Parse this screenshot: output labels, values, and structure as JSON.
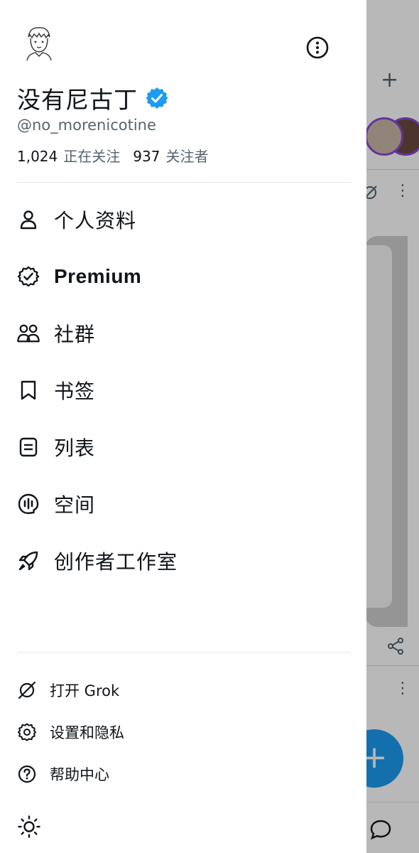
{
  "profile": {
    "display_name": "没有尼古丁",
    "handle": "@no_morenicotine",
    "following_count": "1,024",
    "following_label": "正在关注",
    "followers_count": "937",
    "followers_label": "关注者"
  },
  "menu": [
    {
      "label": "个人资料",
      "icon": "person-icon"
    },
    {
      "label": "Premium",
      "icon": "premium-badge-icon"
    },
    {
      "label": "社群",
      "icon": "communities-icon"
    },
    {
      "label": "书签",
      "icon": "bookmark-icon"
    },
    {
      "label": "列表",
      "icon": "lists-icon"
    },
    {
      "label": "空间",
      "icon": "spaces-icon"
    },
    {
      "label": "创作者工作室",
      "icon": "rocket-icon"
    }
  ],
  "secondary": [
    {
      "label": "打开 Grok",
      "icon": "grok-icon"
    },
    {
      "label": "设置和隐私",
      "icon": "gear-icon"
    },
    {
      "label": "帮助中心",
      "icon": "help-icon"
    }
  ],
  "colors": {
    "accent": "#1d9bf0",
    "text_primary": "#0f1419",
    "text_secondary": "#536471"
  }
}
